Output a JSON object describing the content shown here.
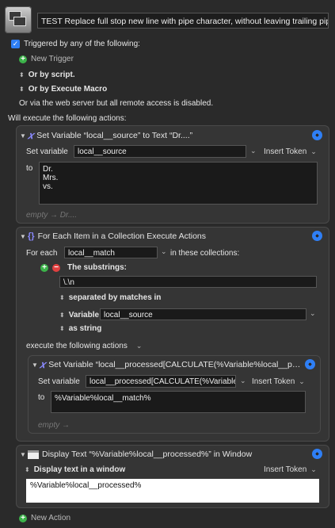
{
  "macro": {
    "title": "TEST Replace full stop new line with pipe character, without leaving trailing pipe"
  },
  "triggers": {
    "checkbox_label": "Triggered by any of the following:",
    "new_trigger": "New Trigger",
    "by_script": "Or by script.",
    "by_execute_macro": "Or by Execute Macro",
    "web_server_note": "Or via the web server but all remote access is disabled."
  },
  "will_execute": "Will execute the following actions:",
  "action1": {
    "title": "Set Variable “local__source” to Text “Dr....”",
    "set_variable_label": "Set variable",
    "variable": "local__source",
    "insert_token": "Insert Token",
    "to_label": "to",
    "text_lines": [
      "Dr.",
      "Mrs.",
      "vs."
    ],
    "result": "empty → Dr...."
  },
  "action2": {
    "title": "For Each Item in a Collection Execute Actions",
    "for_each_label": "For each",
    "variable": "local__match",
    "in_collections_label": "in these collections:",
    "substrings_label": "The substrings:",
    "pattern": "\\.\\n",
    "separated_label": "separated by matches in",
    "source_type": "Variable",
    "source_var": "local__source",
    "as_string": "as string",
    "execute_label": "execute the following actions",
    "nested": {
      "title": "Set Variable “local__processed[CALCULATE(%Variable%local__p…",
      "set_variable_label": "Set variable",
      "variable": "local__processed[CALCULATE(%Variable%",
      "insert_token": "Insert Token",
      "to_label": "to",
      "value": "%Variable%local__match%",
      "result": "empty →"
    }
  },
  "action3": {
    "title": "Display Text “%Variable%local__processed%” in Window",
    "mode": "Display text in a window",
    "insert_token": "Insert Token",
    "value": "%Variable%local__processed%"
  },
  "new_action": "New Action"
}
